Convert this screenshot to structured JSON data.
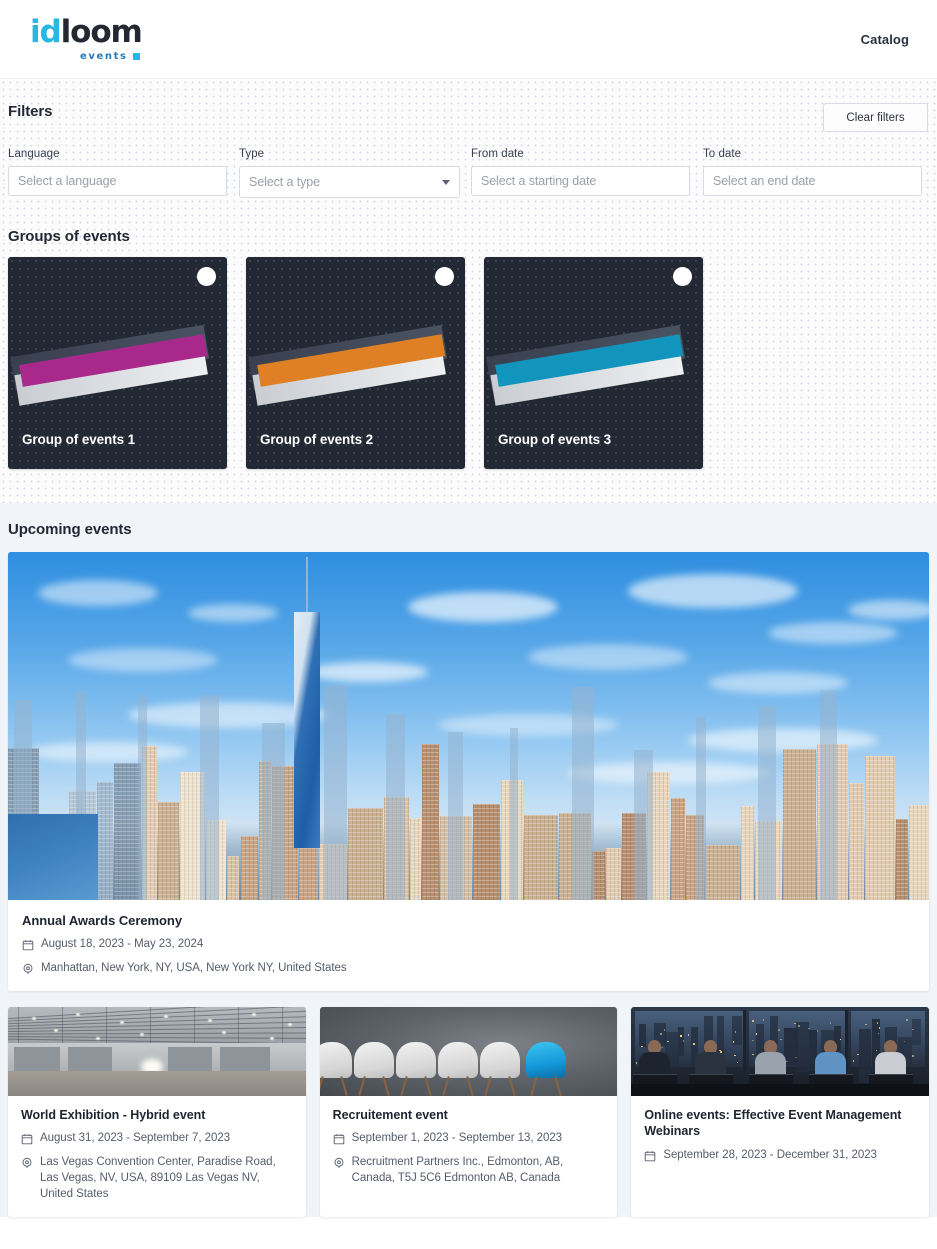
{
  "header": {
    "logo_primary": "id",
    "logo_secondary": "loom",
    "logo_sub": "events",
    "nav_catalog": "Catalog"
  },
  "filters": {
    "title": "Filters",
    "clear_label": "Clear filters",
    "fields": [
      {
        "label": "Language",
        "placeholder": "Select a language",
        "value": "",
        "type": "text",
        "name": "language"
      },
      {
        "label": "Type",
        "placeholder": "Select a type",
        "value": "",
        "type": "select",
        "name": "type"
      },
      {
        "label": "From date",
        "placeholder": "Select a starting date",
        "value": "",
        "type": "date",
        "name": "from-date"
      },
      {
        "label": "To date",
        "placeholder": "Select an end date",
        "value": "",
        "type": "date",
        "name": "to-date"
      }
    ]
  },
  "groups": {
    "title": "Groups of events",
    "items": [
      {
        "title": "Group of events 1",
        "accent": "#a8288c"
      },
      {
        "title": "Group of events 2",
        "accent": "#e08024"
      },
      {
        "title": "Group of events 3",
        "accent": "#1295bd"
      }
    ]
  },
  "upcoming": {
    "title": "Upcoming events",
    "featured": {
      "title": "Annual Awards Ceremony",
      "dates": "August 18, 2023 - May 23, 2024",
      "location": "Manhattan, New York, NY, USA, New York NY, United States",
      "image_alt": "new-york-city-skyline"
    },
    "cards": [
      {
        "title": "World Exhibition - Hybrid event",
        "dates": "August 31, 2023 - September 7, 2023",
        "location": "Las Vegas Convention Center, Paradise Road, Las Vegas, NV, USA, 89109 Las Vegas NV, United States",
        "image_alt": "empty-convention-hall"
      },
      {
        "title": "Recruitement event",
        "dates": "September 1, 2023 - September 13, 2023",
        "location": "Recruitment Partners Inc., Edmonton, AB, Canada, T5J 5C6 Edmonton AB, Canada",
        "image_alt": "row-of-chairs-one-blue"
      },
      {
        "title": "Online events: Effective Event Management Webinars",
        "dates": "September 28, 2023 - December 31, 2023",
        "location": "",
        "image_alt": "team-at-laptops-night-office"
      }
    ]
  },
  "icons": {
    "calendar": "calendar-icon",
    "location": "location-pin-icon",
    "caret": "chevron-down-icon"
  },
  "colors": {
    "brand_blue": "#29b6e5",
    "dark_navy": "#232832",
    "card_dark": "#222834",
    "page_bg": "#fcfcfd",
    "upcoming_bg": "#f1f4f9"
  }
}
